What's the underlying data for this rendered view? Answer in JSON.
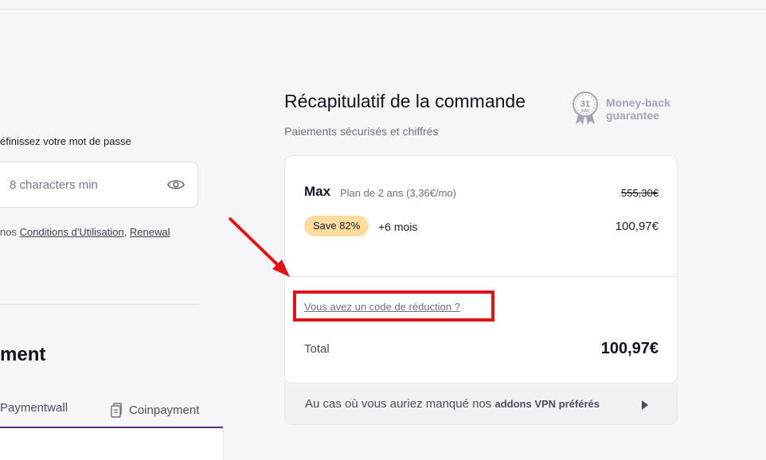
{
  "password": {
    "label": "éfinissez votre mot de passe",
    "placeholder": "8 characters min",
    "terms_prefix": "nos ",
    "terms_link": "Conditions d'Utilisation",
    "terms_sep": ", ",
    "renewal_link": "Renewal"
  },
  "payment": {
    "heading": "ment",
    "tabs": [
      {
        "label": "Paymentwall"
      },
      {
        "label": "Coinpayment"
      }
    ]
  },
  "summary": {
    "title": "Récapitulatif de la commande",
    "subtitle": "Paiements sécurisés et chiffrés",
    "guarantee_days": "31",
    "guarantee_day_word": "DAY",
    "guarantee_line1": "Money-back",
    "guarantee_line2": "guarantee"
  },
  "order": {
    "plan_name": "Max",
    "plan_detail": "Plan de 2 ans (3,36€/mo)",
    "old_price": "555,30€",
    "save_badge": "Save 82%",
    "extra_months": "+6 mois",
    "price": "100,97€",
    "promo_link": "Vous avez un code de réduction ?",
    "total_label": "Total",
    "total_value": "100,97€"
  },
  "addons": {
    "text": "Au cas où vous auriez manqué nos ",
    "text_bold": "addons VPN préférés"
  },
  "colors": {
    "accent": "#5b2a86",
    "badge": "#fddca0",
    "annotation": "#e01414"
  }
}
